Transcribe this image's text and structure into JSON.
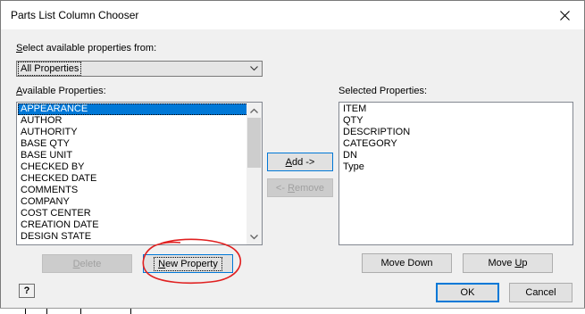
{
  "dialog": {
    "title": "Parts List Column Chooser",
    "close_glyph": "✕"
  },
  "source": {
    "label_prefix": "",
    "label_accel": "S",
    "label_rest": "elect available properties from:",
    "selected_value": "All Properties"
  },
  "available": {
    "label_accel": "A",
    "label_rest": "vailable Properties:",
    "items": [
      "APPEARANCE",
      "AUTHOR",
      "AUTHORITY",
      "BASE QTY",
      "BASE UNIT",
      "CHECKED BY",
      "CHECKED DATE",
      "COMMENTS",
      "COMPANY",
      "COST CENTER",
      "CREATION DATE",
      "DESIGN STATE"
    ],
    "selected_index": 0
  },
  "selected": {
    "label": "Selected Properties:",
    "items": [
      "ITEM",
      "QTY",
      "DESCRIPTION",
      "CATEGORY",
      "DN",
      "Type"
    ]
  },
  "buttons": {
    "add_accel": "A",
    "add_rest": "dd ->",
    "remove_prefix": "<- ",
    "remove_accel": "R",
    "remove_rest": "emove",
    "delete_accel": "D",
    "delete_rest": "elete",
    "new_property_accel": "N",
    "new_property_rest": "ew Property",
    "move_down": "Move Down",
    "move_up_prefix": "Move ",
    "move_up_accel": "U",
    "move_up_rest": "p",
    "ok": "OK",
    "cancel": "Cancel",
    "help_glyph": "?"
  },
  "colors": {
    "selection": "#0078d7",
    "annotation": "#e02020"
  }
}
